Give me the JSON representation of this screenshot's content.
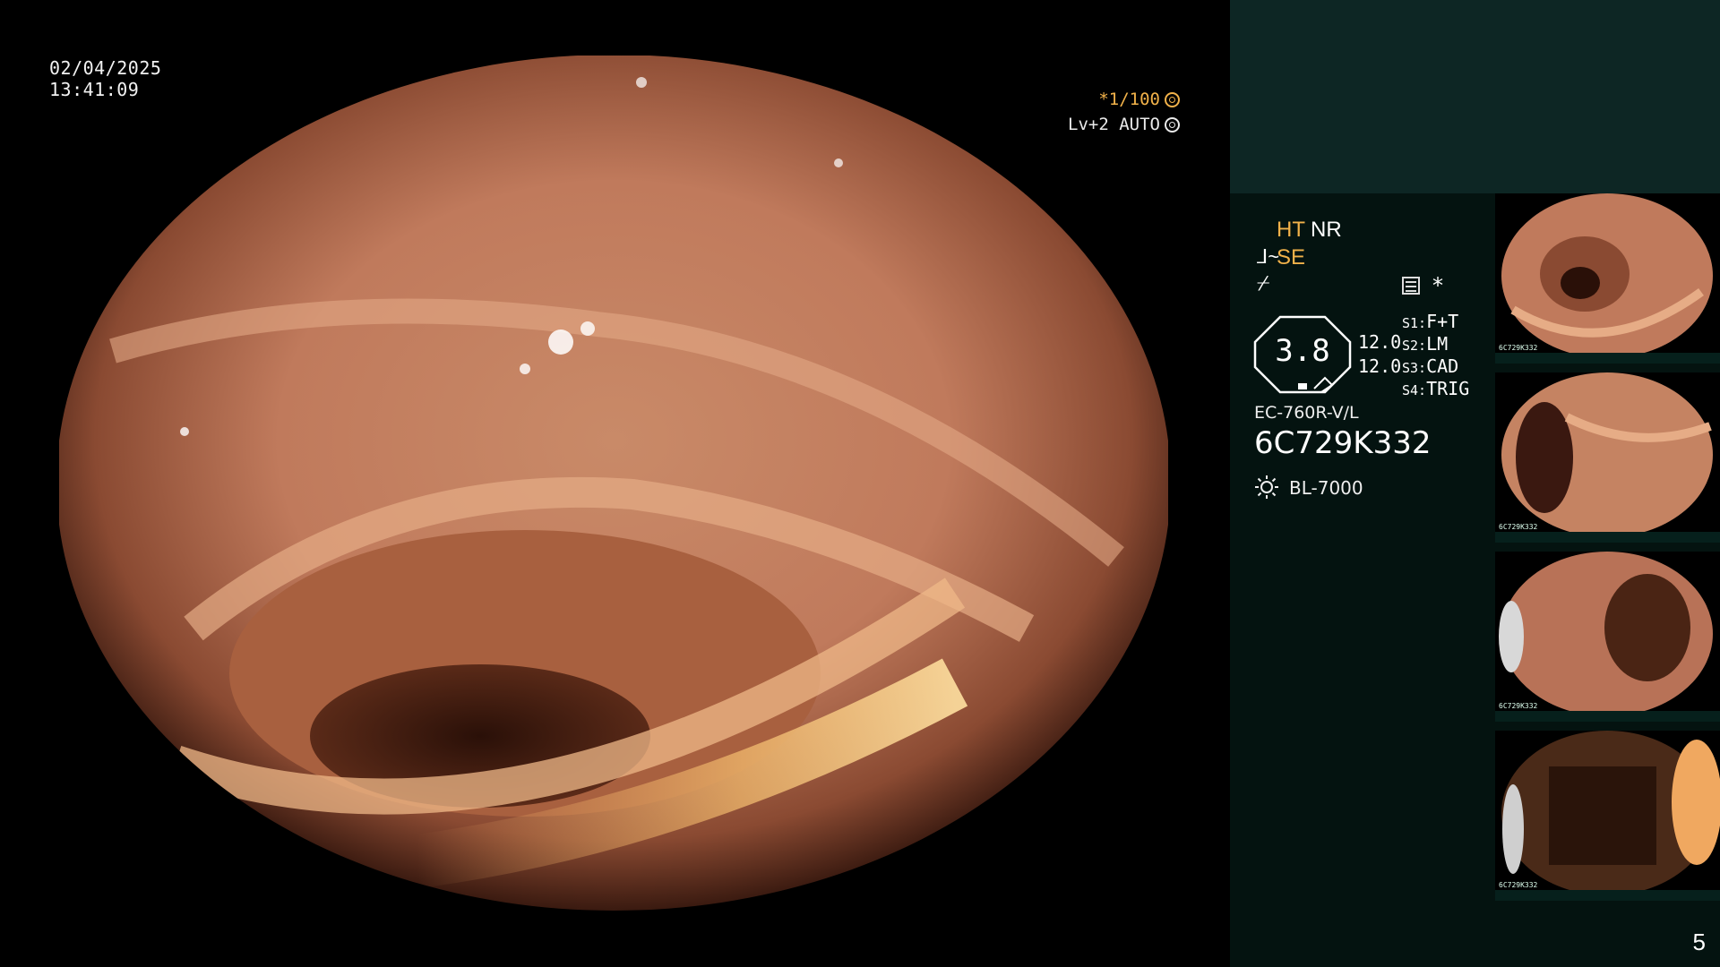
{
  "overlay": {
    "date": "02/04/2025",
    "time": "13:41:09",
    "shutter": "*1/100",
    "shutter_icon": "aperture-icon",
    "iris": "Lv+2 AUTO",
    "iris_icon": "iris-icon"
  },
  "status_panel": {
    "ht": "HT",
    "nr": "NR",
    "se_icon_glyph": "⅃~",
    "se": "SE",
    "noise_glyph": "⌿",
    "star": "*",
    "zoom": "3.8",
    "level_1": "12.0",
    "level_2": "12.0",
    "switches": [
      {
        "key": "S1:",
        "value": "F+T"
      },
      {
        "key": "S2:",
        "value": "LM"
      },
      {
        "key": "S3:",
        "value": "CAD"
      },
      {
        "key": "S4:",
        "value": "TRIG"
      }
    ],
    "scope_model": "EC-760R-V/L",
    "scope_serial": "6C729K332",
    "light_source": "BL-7000",
    "light_icon": "sun-icon"
  },
  "thumbnails": [
    {
      "label": "6C729K332"
    },
    {
      "label": "6C729K332"
    },
    {
      "label": "6C729K332"
    },
    {
      "label": "6C729K332"
    }
  ],
  "page_number": "5",
  "colors": {
    "accent": "#f2b24a",
    "panel_bg": "#041310",
    "panel_top": "#0d2624"
  }
}
